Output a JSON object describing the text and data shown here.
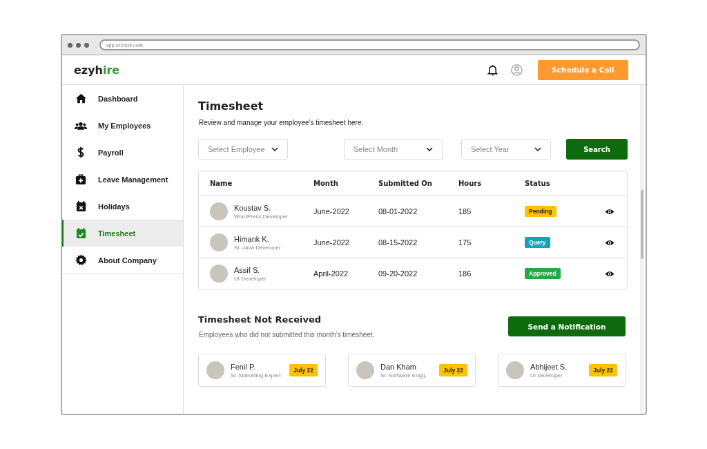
{
  "browser": {
    "url": "app.ezyhire.com"
  },
  "header": {
    "logo": [
      {
        "text": "ezyh",
        "accent": false
      },
      {
        "text": "ire",
        "accent": true
      }
    ],
    "cta": "Schedule a Call"
  },
  "sidebar": {
    "items": [
      {
        "label": "Dashboard",
        "kind": "home",
        "selected": false
      },
      {
        "label": "My Employees",
        "kind": "users",
        "selected": false
      },
      {
        "label": "Payroll",
        "kind": "dollar",
        "selected": false
      },
      {
        "label": "Leave Management",
        "kind": "medkit",
        "selected": false
      },
      {
        "label": "Holidays",
        "kind": "calendar-x",
        "selected": false
      },
      {
        "label": "Timesheet",
        "kind": "calendar-check",
        "selected": true
      },
      {
        "label": "About Company",
        "kind": "gear",
        "selected": false
      }
    ]
  },
  "page": {
    "title": "Timesheet",
    "subtitle": "Review and manage your employee’s timesheet here.",
    "filters": [
      {
        "placeholder": "Select Employee"
      },
      {
        "placeholder": "Select Month"
      },
      {
        "placeholder": "Select Year"
      }
    ],
    "search_button": "Search"
  },
  "table": {
    "columns": [
      "Name",
      "Month",
      "Submitted On",
      "Hours",
      "Status"
    ],
    "rows": [
      {
        "name": "Koustav S.",
        "role": "WordPress Developer",
        "month": "June-2022",
        "submitted_on": "08-01-2022",
        "hours": "185",
        "status": {
          "label": "Pending",
          "color": "#ffc107"
        }
      },
      {
        "name": "Himank K.",
        "role": "Sr. Java Developer",
        "month": "June-2022",
        "submitted_on": "08-15-2022",
        "hours": "175",
        "status": {
          "label": "Query",
          "color": "#17a2b8"
        }
      },
      {
        "name": "Assif S.",
        "role": "UI Developer",
        "month": "April-2022",
        "submitted_on": "09-20-2022",
        "hours": "186",
        "status": {
          "label": "Approved",
          "color": "#28a745"
        }
      }
    ]
  },
  "not_received": {
    "title": "Timesheet Not Received",
    "subtitle": "Employees who did not submitted this month’s timesheet.",
    "button": "Send a Notification",
    "cards": [
      {
        "name": "Fenil P.",
        "role": "Sr. Marketing Expert",
        "badge": "July 22"
      },
      {
        "name": "Dan Kham",
        "role": "Sr. Software Engg.",
        "badge": "July 22"
      },
      {
        "name": "Abhijeet S.",
        "role": "UI Developer",
        "badge": "July 22"
      }
    ]
  }
}
